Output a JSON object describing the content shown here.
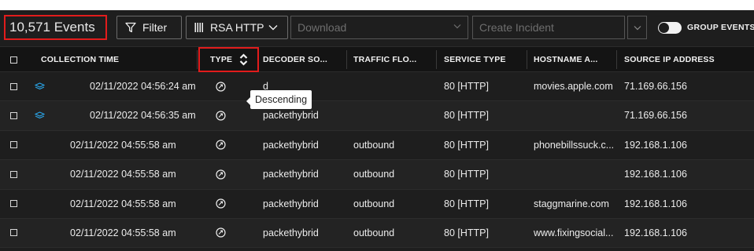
{
  "toolbar": {
    "event_count": "10,571 Events",
    "filter_label": "Filter",
    "profile_label": "RSA HTTP",
    "download_placeholder": "Download",
    "create_incident_placeholder": "Create Incident",
    "group_events_label": "GROUP EVENTS",
    "group_events_on": false
  },
  "columns": {
    "collection_time": "COLLECTION TIME",
    "type": "TYPE",
    "decoder_source": "DECODER SO...",
    "traffic_flow": "TRAFFIC FLO...",
    "service_type": "SERVICE TYPE",
    "hostname": "HOSTNAME A...",
    "source_ip": "SOURCE IP ADDRESS"
  },
  "tooltip": "Descending",
  "rows": [
    {
      "grouped": true,
      "time": "02/11/2022 04:56:24 am",
      "decoder": "d",
      "traffic": "",
      "service": "80 [HTTP]",
      "hostname": "movies.apple.com",
      "ip": "71.169.66.156"
    },
    {
      "grouped": true,
      "time": "02/11/2022 04:56:35 am",
      "decoder": "packethybrid",
      "traffic": "",
      "service": "80 [HTTP]",
      "hostname": "",
      "ip": "71.169.66.156"
    },
    {
      "grouped": false,
      "time": "02/11/2022 04:55:58 am",
      "decoder": "packethybrid",
      "traffic": "outbound",
      "service": "80 [HTTP]",
      "hostname": "phonebillssuck.c...",
      "ip": "192.168.1.106"
    },
    {
      "grouped": false,
      "time": "02/11/2022 04:55:58 am",
      "decoder": "packethybrid",
      "traffic": "outbound",
      "service": "80 [HTTP]",
      "hostname": "",
      "ip": "192.168.1.106"
    },
    {
      "grouped": false,
      "time": "02/11/2022 04:55:58 am",
      "decoder": "packethybrid",
      "traffic": "outbound",
      "service": "80 [HTTP]",
      "hostname": "staggmarine.com",
      "ip": "192.168.1.106"
    },
    {
      "grouped": false,
      "time": "02/11/2022 04:55:58 am",
      "decoder": "packethybrid",
      "traffic": "outbound",
      "service": "80 [HTTP]",
      "hostname": "www.fixingsocial...",
      "ip": "192.168.1.106"
    }
  ],
  "colors": {
    "highlight": "#e21c1c",
    "panel_bg": "#1e1e1e",
    "group_icon": "#2aa5e8"
  },
  "icons": {
    "filter": "filter-funnel-icon",
    "profile": "columns-bars-icon",
    "sort": "sort-updown-icon",
    "group": "layers-stack-icon",
    "type": "network-session-icon"
  }
}
